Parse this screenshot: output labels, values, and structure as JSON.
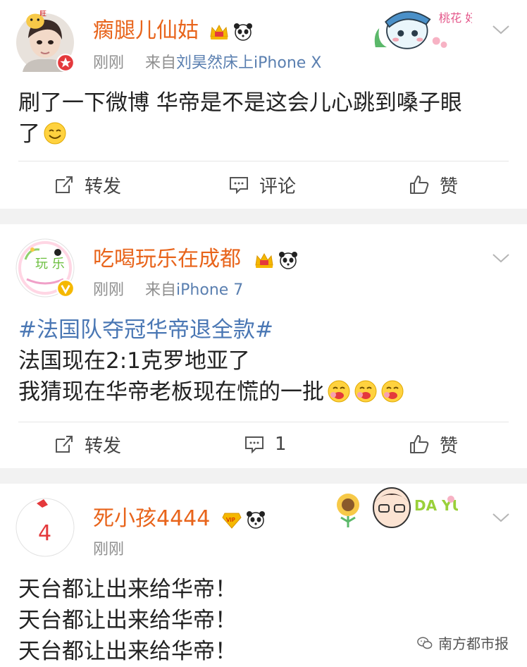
{
  "posts": [
    {
      "username": "瘸腿儿仙姑",
      "time": "刚刚",
      "via_prefix": "来自",
      "via_source": "刘昊然床上iPhone X",
      "text_lines": [
        "刷了一下微博 华帝是不是这会儿心跳到嗓子眼",
        "了"
      ],
      "actions": {
        "repost": "转发",
        "comment": "评论",
        "like": "赞"
      },
      "sticker_text": "桃花 好旺"
    },
    {
      "username": "吃喝玩乐在成都",
      "time": "刚刚",
      "via_prefix": "来自",
      "via_source": "iPhone 7",
      "topic": "#法国队夺冠华帝退全款#",
      "text_lines": [
        "法国现在2:1克罗地亚了",
        "我猜现在华帝老板现在慌的一批"
      ],
      "actions": {
        "repost": "转发",
        "comment": "1",
        "like": "赞"
      },
      "avatar_text": "玩 乐"
    },
    {
      "username": "死小孩4444",
      "time": "刚刚",
      "text_lines": [
        "天台都让出来给华帝！",
        "天台都让出来给华帝！",
        "天台都让出来给华帝！"
      ],
      "avatar_text": "4",
      "sticker_text": "DA YUAN"
    }
  ],
  "watermark": "南方都市报",
  "colors": {
    "username": "#e8641b",
    "meta": "#8f8f8f",
    "source": "#5a7fb0",
    "topic": "#4a77b4",
    "gold": "#f5b800"
  }
}
